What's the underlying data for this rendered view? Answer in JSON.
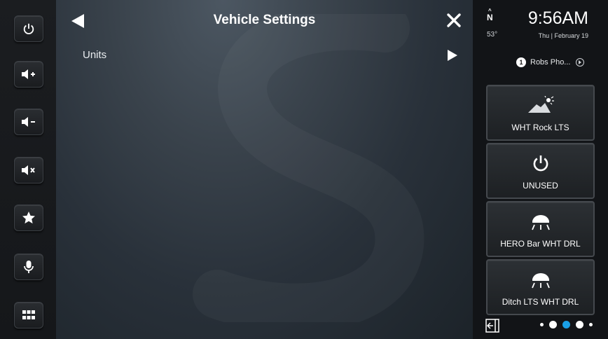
{
  "left_rail": {
    "buttons": [
      {
        "icon": "power-icon"
      },
      {
        "icon": "volume-up-icon"
      },
      {
        "icon": "volume-down-icon"
      },
      {
        "icon": "mute-icon"
      },
      {
        "icon": "star-icon"
      },
      {
        "icon": "microphone-icon"
      },
      {
        "icon": "app-grid-icon"
      }
    ]
  },
  "header": {
    "title": "Vehicle Settings",
    "back_icon": "back-arrow-icon",
    "close_icon": "close-icon"
  },
  "settings": {
    "items": [
      {
        "label": "Units",
        "icon": "chevron-right-icon"
      }
    ]
  },
  "status": {
    "heading": "N",
    "temperature": "53°",
    "time": "9:56AM",
    "date": "Thu | February 19"
  },
  "phone": {
    "badge": "1",
    "name": "Robs Pho..."
  },
  "tiles": [
    {
      "label": "WHT Rock LTS",
      "icon": "rock-light-icon"
    },
    {
      "label": "UNUSED",
      "icon": "power-icon"
    },
    {
      "label": "HERO Bar WHT DRL",
      "icon": "dome-light-icon"
    },
    {
      "label": "Ditch LTS WHT DRL",
      "icon": "dome-light-icon"
    }
  ],
  "pager": {
    "page_count": 5,
    "active_page": 3
  },
  "colors": {
    "accent": "#1a9fe6",
    "tile_border": "#45494e"
  }
}
